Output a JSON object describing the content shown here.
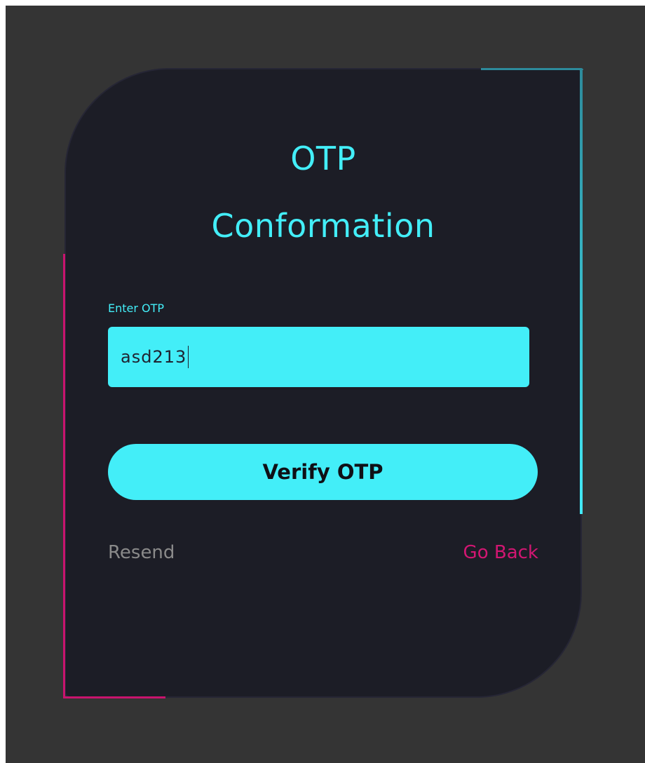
{
  "form": {
    "title_line1": "OTP",
    "title_line2": "Conformation",
    "otp_label": "Enter OTP",
    "otp_value": "asd213",
    "verify_label": "Verify OTP",
    "resend_label": "Resend",
    "go_back_label": "Go Back"
  },
  "colors": {
    "page_background": "#343434",
    "card_background": "#1c1d26",
    "accent_cyan": "#43eef8",
    "accent_pink": "#d21672",
    "muted_text": "#8a8a8a"
  }
}
